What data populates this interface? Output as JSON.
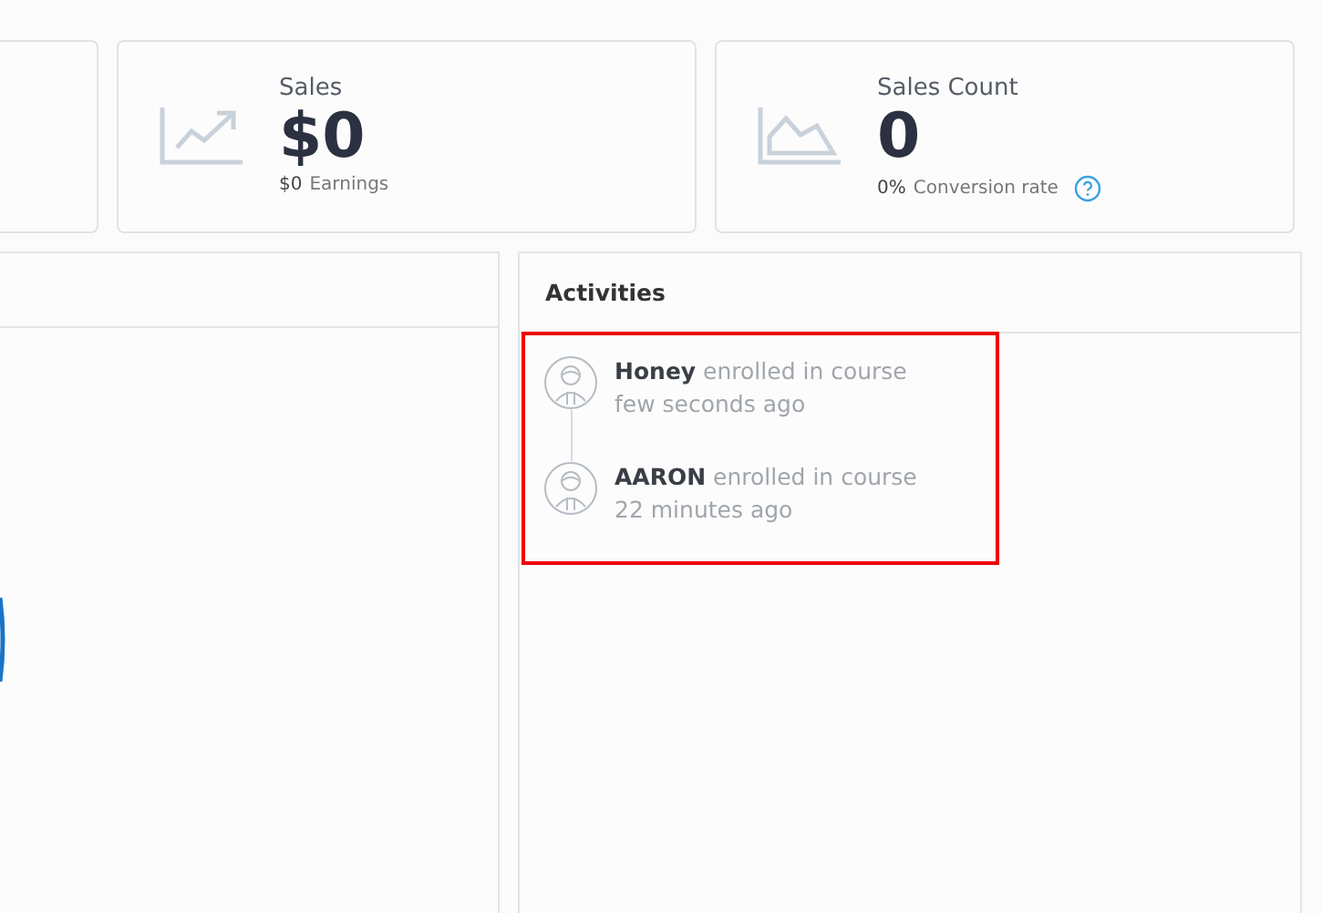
{
  "stat_cards": [
    {
      "kind": "sales",
      "title": "Sales",
      "value": "$0",
      "sub_value": "$0",
      "sub_label": "Earnings",
      "help": false
    },
    {
      "kind": "count",
      "title": "Sales Count",
      "value": "0",
      "sub_value": "0%",
      "sub_label": "Conversion rate",
      "help": true
    }
  ],
  "activities": {
    "title": "Activities",
    "items": [
      {
        "name": "Honey",
        "action": "enrolled in course",
        "time": "few seconds ago"
      },
      {
        "name": "AARON",
        "action": "enrolled in course",
        "time": "22 minutes ago"
      }
    ]
  }
}
